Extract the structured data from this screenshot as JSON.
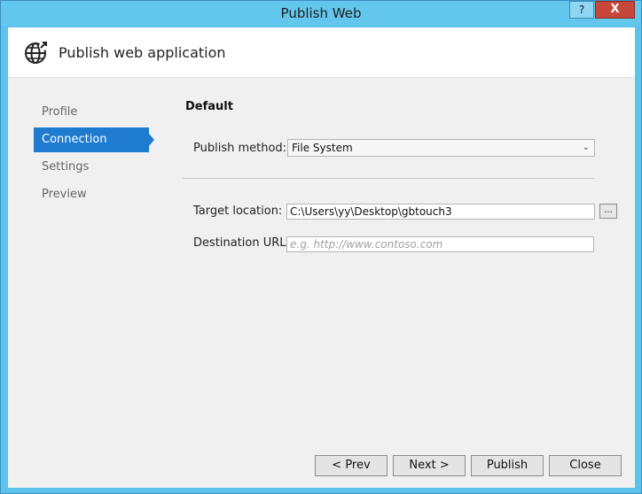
{
  "window": {
    "title": "Publish Web",
    "help_label": "?",
    "close_label": "X"
  },
  "header": {
    "title": "Publish web application",
    "icon": "globe-publish-icon"
  },
  "nav": {
    "items": [
      {
        "label": "Profile"
      },
      {
        "label": "Connection"
      },
      {
        "label": "Settings"
      },
      {
        "label": "Preview"
      }
    ],
    "active_index": 1
  },
  "content": {
    "section_title": "Default",
    "publish_method": {
      "label": "Publish method:",
      "value": "File System"
    },
    "target_location": {
      "label": "Target location:",
      "value": "C:\\Users\\yy\\Desktop\\gbtouch3",
      "browse_label": "..."
    },
    "destination_url": {
      "label": "Destination URL:",
      "placeholder": "e.g. http://www.contoso.com"
    }
  },
  "footer": {
    "prev_label": "< Prev",
    "next_label": "Next >",
    "publish_label": "Publish",
    "close_label": "Close"
  },
  "colors": {
    "accent": "#1e7bd0",
    "titlebar": "#63c6ec",
    "close_button": "#c7473b"
  }
}
